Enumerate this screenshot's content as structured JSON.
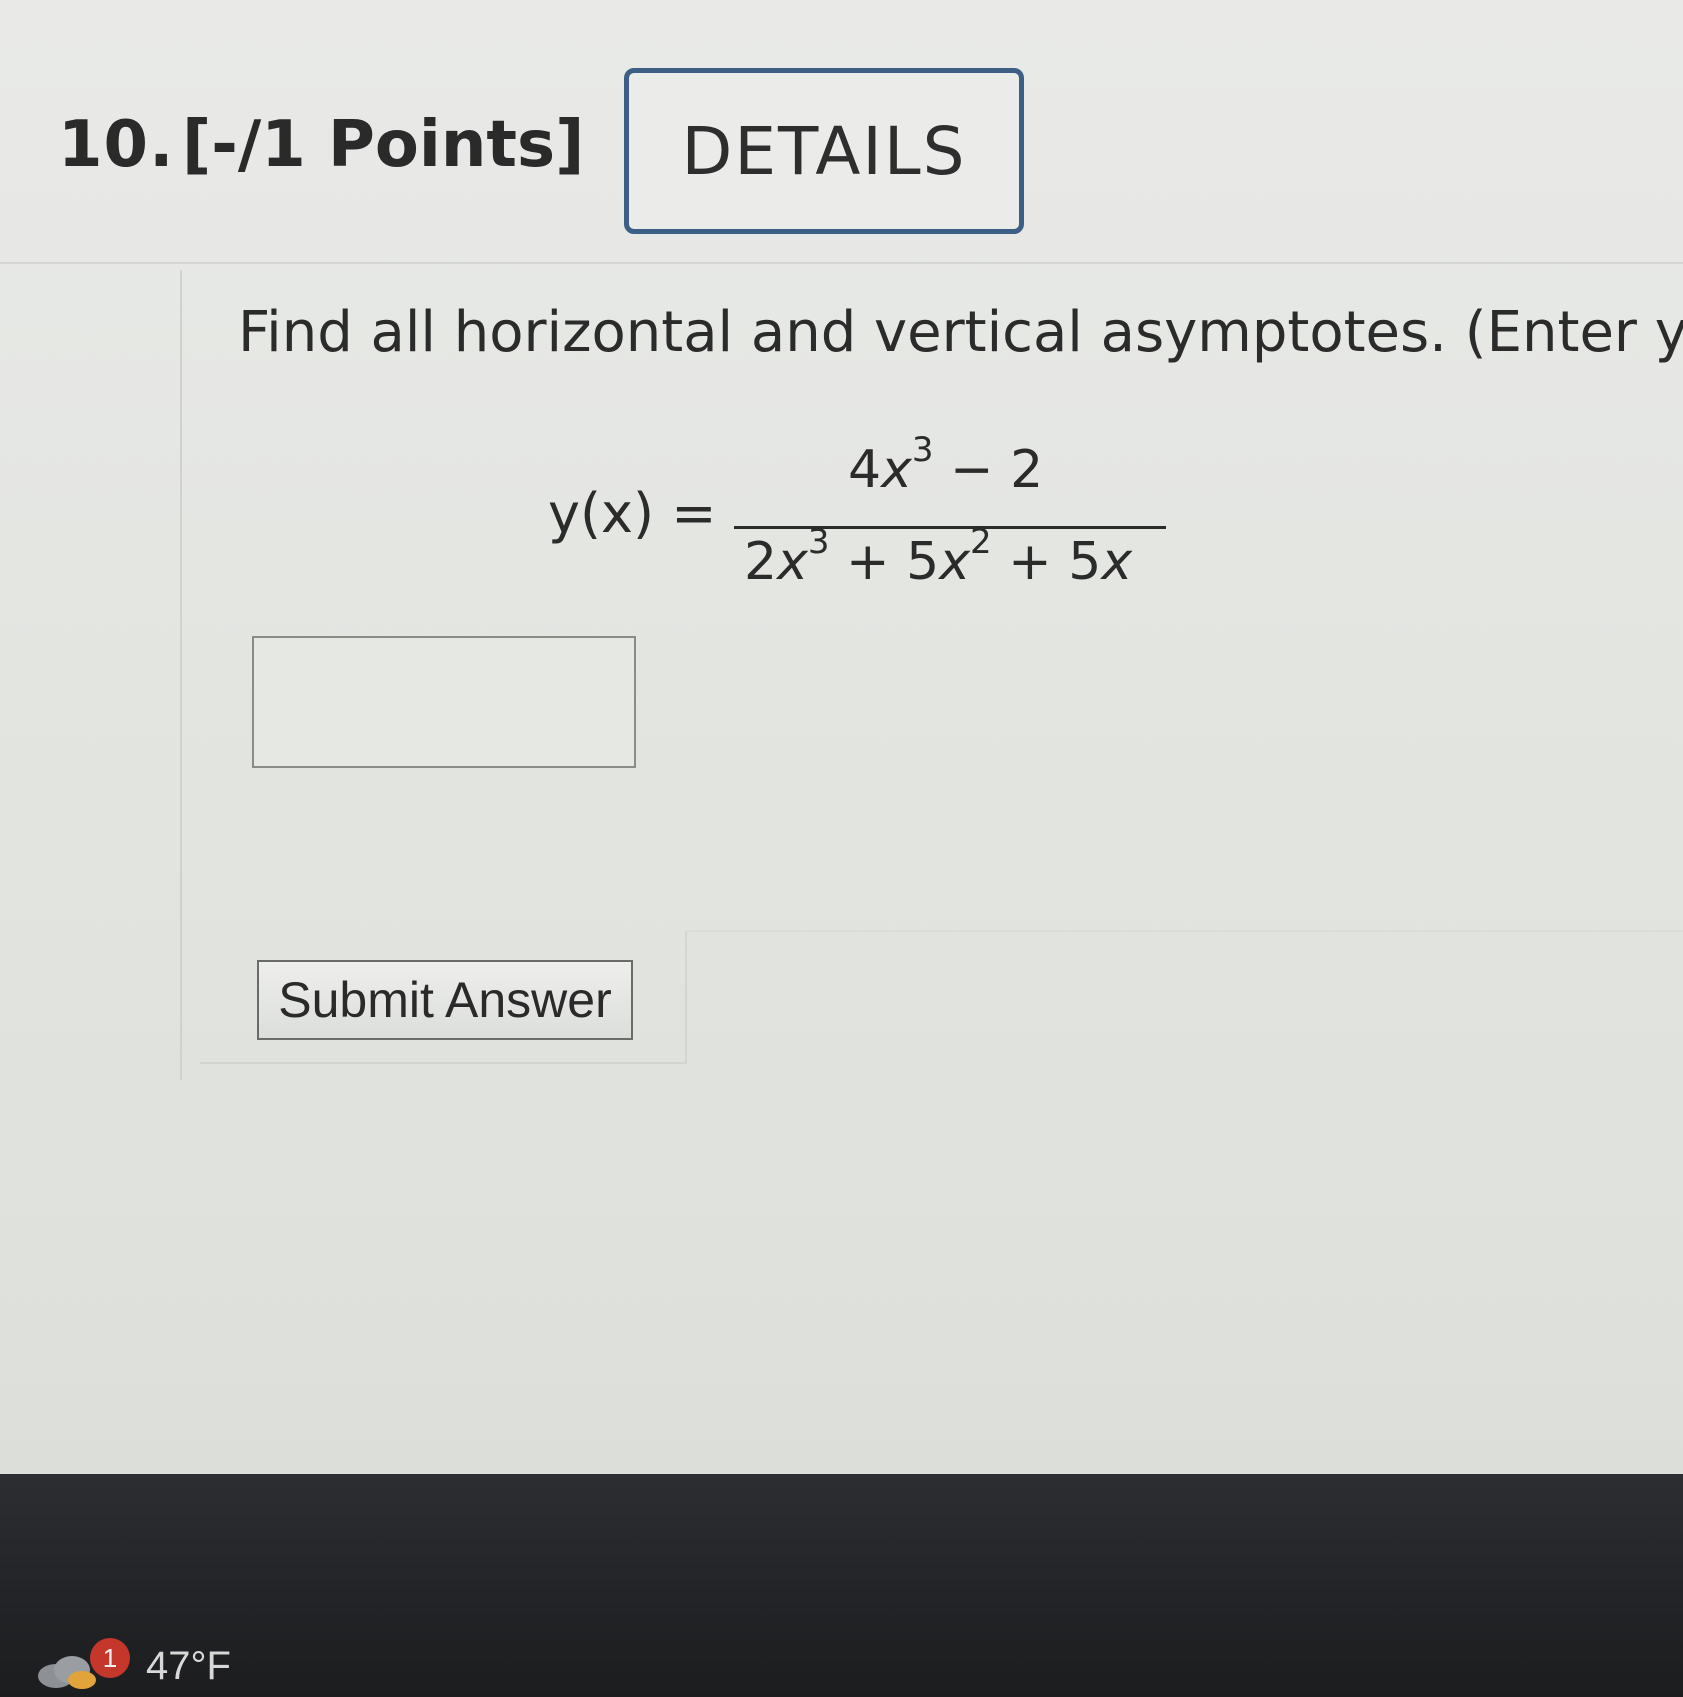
{
  "question": {
    "number": "10.",
    "points": "[-/1 Points]",
    "details_label": "DETAILS",
    "prompt": "Find all horizontal and vertical asymptotes. (Enter you"
  },
  "formula": {
    "lhs": "y(x) =",
    "numerator": {
      "coef": "4",
      "var": "x",
      "exp": "3",
      "rest": " − 2"
    },
    "denominator": {
      "t1_coef": "2",
      "t1_var": "x",
      "t1_exp": "3",
      "t2_coef": " + 5",
      "t2_var": "x",
      "t2_exp": "2",
      "t3": " + 5",
      "t3_var": "x"
    }
  },
  "answer": {
    "value": "",
    "placeholder": ""
  },
  "submit_label": "Submit Answer",
  "taskbar": {
    "weather_badge": "1",
    "temperature": "47°F",
    "weather_icon": "cloud-icon"
  }
}
